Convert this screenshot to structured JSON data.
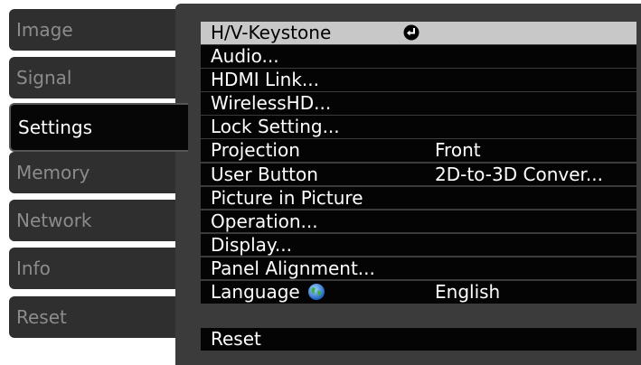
{
  "tabs": [
    {
      "label": "Image"
    },
    {
      "label": "Signal"
    },
    {
      "label": "Settings"
    },
    {
      "label": "Memory"
    },
    {
      "label": "Network"
    },
    {
      "label": "Info"
    },
    {
      "label": "Reset"
    }
  ],
  "menu": {
    "items": [
      {
        "label": "H/V-Keystone",
        "value": ""
      },
      {
        "label": "Audio...",
        "value": ""
      },
      {
        "label": "HDMI Link...",
        "value": ""
      },
      {
        "label": "WirelessHD...",
        "value": ""
      },
      {
        "label": "Lock Setting...",
        "value": ""
      },
      {
        "label": "Projection",
        "value": "Front"
      },
      {
        "label": "User Button",
        "value": "2D-to-3D Conver..."
      },
      {
        "label": "Picture in Picture",
        "value": ""
      },
      {
        "label": "Operation...",
        "value": ""
      },
      {
        "label": "Display...",
        "value": ""
      },
      {
        "label": "Panel Alignment...",
        "value": ""
      },
      {
        "label": "Language",
        "value": "English"
      }
    ],
    "reset_label": "Reset"
  },
  "icons": {
    "enter": "enter-return-icon",
    "language": "globe-icon"
  },
  "colors": {
    "selected_row": "#c8c8c8",
    "row_bg": "#040404",
    "panel_bg": "#3b3b3b",
    "inactive_tab": "#2f2f2f"
  }
}
